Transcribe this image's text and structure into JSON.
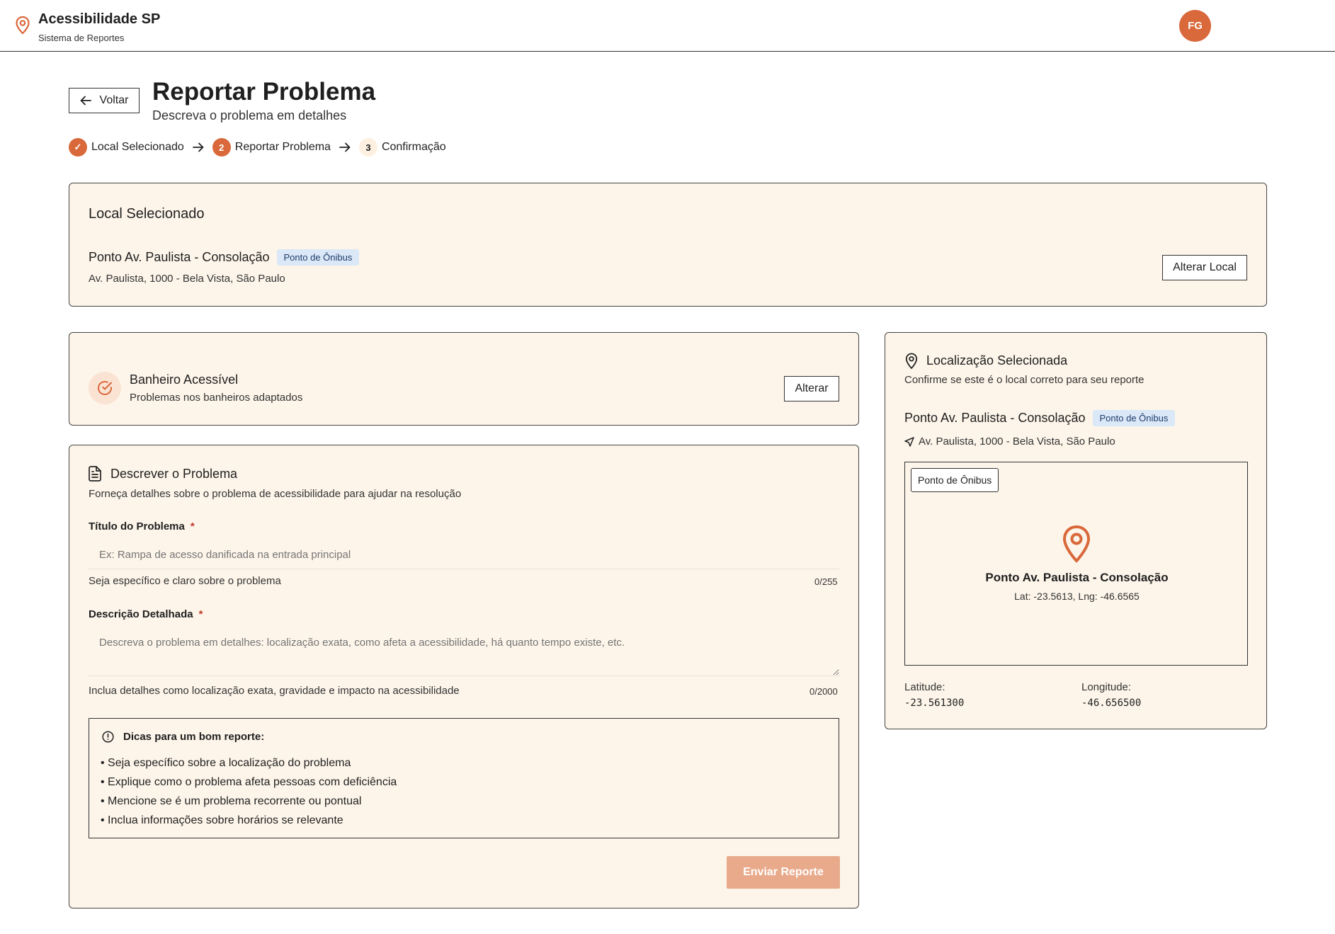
{
  "header": {
    "app_title": "Acessibilidade SP",
    "app_subtitle": "Sistema de Reportes",
    "avatar_initials": "FG"
  },
  "page": {
    "back_label": "Voltar",
    "title": "Reportar Problema",
    "subtitle": "Descreva o problema em detalhes"
  },
  "steps": [
    {
      "marker": "✓",
      "label": "Local Selecionado",
      "state": "done"
    },
    {
      "marker": "2",
      "label": "Reportar Problema",
      "state": "active"
    },
    {
      "marker": "3",
      "label": "Confirmação",
      "state": "todo"
    }
  ],
  "local_card": {
    "heading": "Local Selecionado",
    "place_name": "Ponto Av. Paulista - Consolação",
    "place_type": "Ponto de Ônibus",
    "address": "Av. Paulista, 1000 - Bela Vista, São Paulo",
    "change_label": "Alterar Local"
  },
  "category_card": {
    "title": "Banheiro Acessível",
    "description": "Problemas nos banheiros adaptados",
    "change_label": "Alterar"
  },
  "describe_card": {
    "heading": "Descrever o Problema",
    "intro": "Forneça detalhes sobre o problema de acessibilidade para ajudar na resolução",
    "title_field": {
      "label": "Título do Problema",
      "required_mark": "*",
      "placeholder": "Ex: Rampa de acesso danificada na entrada principal",
      "value": "",
      "hint": "Seja específico e claro sobre o problema",
      "counter": "0/255"
    },
    "description_field": {
      "label": "Descrição Detalhada",
      "required_mark": "*",
      "placeholder": "Descreva o problema em detalhes: localização exata, como afeta a acessibilidade, há quanto tempo existe, etc.",
      "value": "",
      "hint": "Inclua detalhes como localização exata, gravidade e impacto na acessibilidade",
      "counter": "0/2000"
    },
    "tips": {
      "heading": "Dicas para um bom reporte:",
      "items": [
        "• Seja específico sobre a localização do problema",
        "• Explique como o problema afeta pessoas com deficiência",
        "• Mencione se é um problema recorrente ou pontual",
        "• Inclua informações sobre horários se relevante"
      ]
    },
    "submit_label": "Enviar Reporte"
  },
  "location_card": {
    "heading": "Localização Selecionada",
    "subtitle": "Confirme se este é o local correto para seu reporte",
    "place_name": "Ponto Av. Paulista - Consolação",
    "place_type": "Ponto de Ônibus",
    "address": "Av. Paulista, 1000 - Bela Vista, São Paulo",
    "map_chip": "Ponto de Ônibus",
    "map_place_name": "Ponto Av. Paulista - Consolação",
    "map_coords": "Lat: -23.5613, Lng: -46.6565",
    "latitude_label": "Latitude:",
    "latitude_value": "-23.561300",
    "longitude_label": "Longitude:",
    "longitude_value": "-46.656500"
  },
  "colors": {
    "accent": "#d9683a",
    "card_bg": "#fdf5ea",
    "badge_bg": "#dbe8f7",
    "submit_disabled": "#e9aa8b"
  },
  "icons": {
    "brand": "map-pin-icon",
    "back": "arrow-left-icon",
    "step_separator": "arrow-right-icon",
    "category": "check-circle-icon",
    "describe": "document-icon",
    "tips": "alert-circle-icon",
    "location": "map-pin-icon",
    "address": "navigation-icon",
    "map_marker": "map-pin-icon"
  }
}
